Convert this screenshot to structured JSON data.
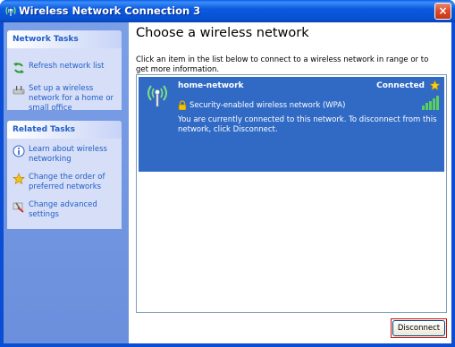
{
  "window": {
    "title": "Wireless Network Connection 3",
    "close_label": "×"
  },
  "sidebar": {
    "network_tasks": {
      "header": "Network Tasks",
      "items": [
        {
          "label": "Refresh network list",
          "icon": "refresh-icon"
        },
        {
          "label": "Set up a wireless network for a home or small office",
          "icon": "setup-wireless-icon"
        }
      ]
    },
    "related_tasks": {
      "header": "Related Tasks",
      "items": [
        {
          "label": "Learn about wireless networking",
          "icon": "info-icon"
        },
        {
          "label": "Change the order of preferred networks",
          "icon": "star-icon"
        },
        {
          "label": "Change advanced settings",
          "icon": "settings-icon"
        }
      ]
    }
  },
  "main": {
    "title": "Choose a wireless network",
    "instructions": "Click an item in the list below to connect to a wireless network in range or to get more information.",
    "networks": [
      {
        "name": "home-network",
        "status": "Connected",
        "security": "Security-enabled wireless network (WPA)",
        "description": "You are currently connected to this network. To disconnect from this network, click Disconnect.",
        "selected": true
      }
    ],
    "disconnect_label": "Disconnect"
  },
  "colors": {
    "title_bar": "#0a5ae0",
    "sidebar": "#6b8fdc",
    "link": "#215dc6",
    "selection": "#316ac5",
    "focus_outline": "#c8140a"
  }
}
